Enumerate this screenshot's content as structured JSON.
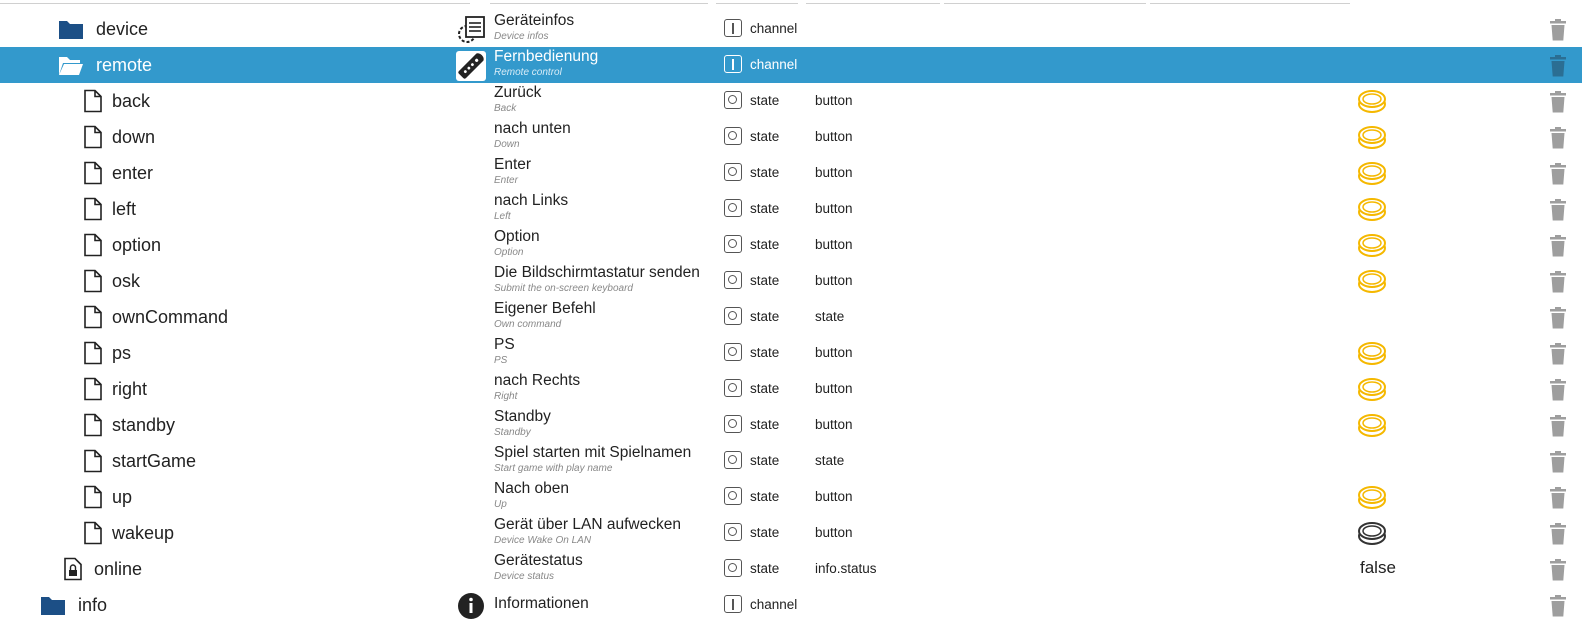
{
  "rows": [
    {
      "name": "device",
      "indent": 0,
      "tree_icon": "folder-icon",
      "role_icon": "device-info-icon",
      "title": "Geräteinfos",
      "subtitle": "Device infos",
      "type": "channel",
      "role": "",
      "value": "",
      "value_kind": "none",
      "selected": false
    },
    {
      "name": "remote",
      "indent": 0,
      "tree_icon": "folder-open-icon",
      "role_icon": "remote-control-icon",
      "title": "Fernbedienung",
      "subtitle": "Remote control",
      "type": "channel",
      "role": "",
      "value": "",
      "value_kind": "none",
      "selected": true
    },
    {
      "name": "back",
      "indent": 1,
      "tree_icon": "file-icon",
      "role_icon": "",
      "title": "Zurück",
      "subtitle": "Back",
      "type": "state",
      "role": "button",
      "value": "",
      "value_kind": "button-yellow",
      "selected": false
    },
    {
      "name": "down",
      "indent": 1,
      "tree_icon": "file-icon",
      "role_icon": "",
      "title": "nach unten",
      "subtitle": "Down",
      "type": "state",
      "role": "button",
      "value": "",
      "value_kind": "button-yellow",
      "selected": false
    },
    {
      "name": "enter",
      "indent": 1,
      "tree_icon": "file-icon",
      "role_icon": "",
      "title": "Enter",
      "subtitle": "Enter",
      "type": "state",
      "role": "button",
      "value": "",
      "value_kind": "button-yellow",
      "selected": false
    },
    {
      "name": "left",
      "indent": 1,
      "tree_icon": "file-icon",
      "role_icon": "",
      "title": "nach Links",
      "subtitle": "Left",
      "type": "state",
      "role": "button",
      "value": "",
      "value_kind": "button-yellow",
      "selected": false
    },
    {
      "name": "option",
      "indent": 1,
      "tree_icon": "file-icon",
      "role_icon": "",
      "title": "Option",
      "subtitle": "Option",
      "type": "state",
      "role": "button",
      "value": "",
      "value_kind": "button-yellow",
      "selected": false
    },
    {
      "name": "osk",
      "indent": 1,
      "tree_icon": "file-icon",
      "role_icon": "",
      "title": "Die Bildschirmtastatur senden",
      "subtitle": "Submit the on-screen keyboard",
      "type": "state",
      "role": "button",
      "value": "",
      "value_kind": "button-yellow",
      "selected": false
    },
    {
      "name": "ownCommand",
      "indent": 1,
      "tree_icon": "file-icon",
      "role_icon": "",
      "title": "Eigener Befehl",
      "subtitle": "Own command",
      "type": "state",
      "role": "state",
      "value": "",
      "value_kind": "none",
      "selected": false
    },
    {
      "name": "ps",
      "indent": 1,
      "tree_icon": "file-icon",
      "role_icon": "",
      "title": "PS",
      "subtitle": "PS",
      "type": "state",
      "role": "button",
      "value": "",
      "value_kind": "button-yellow",
      "selected": false
    },
    {
      "name": "right",
      "indent": 1,
      "tree_icon": "file-icon",
      "role_icon": "",
      "title": "nach Rechts",
      "subtitle": "Right",
      "type": "state",
      "role": "button",
      "value": "",
      "value_kind": "button-yellow",
      "selected": false
    },
    {
      "name": "standby",
      "indent": 1,
      "tree_icon": "file-icon",
      "role_icon": "",
      "title": "Standby",
      "subtitle": "Standby",
      "type": "state",
      "role": "button",
      "value": "",
      "value_kind": "button-yellow",
      "selected": false
    },
    {
      "name": "startGame",
      "indent": 1,
      "tree_icon": "file-icon",
      "role_icon": "",
      "title": "Spiel starten mit Spielnamen",
      "subtitle": "Start game with play name",
      "type": "state",
      "role": "state",
      "value": "",
      "value_kind": "none",
      "selected": false
    },
    {
      "name": "up",
      "indent": 1,
      "tree_icon": "file-icon",
      "role_icon": "",
      "title": "Nach oben",
      "subtitle": "Up",
      "type": "state",
      "role": "button",
      "value": "",
      "value_kind": "button-yellow",
      "selected": false
    },
    {
      "name": "wakeup",
      "indent": 1,
      "tree_icon": "file-icon",
      "role_icon": "",
      "title": "Gerät über LAN aufwecken",
      "subtitle": "Device Wake On LAN",
      "type": "state",
      "role": "button",
      "value": "",
      "value_kind": "button-dark",
      "selected": false
    },
    {
      "name": "online",
      "indent": 0,
      "tree_icon": "file-lock-icon",
      "role_icon": "",
      "title": "Gerätestatus",
      "subtitle": "Device status",
      "type": "state",
      "role": "info.status",
      "value": "false",
      "value_kind": "text",
      "selected": false
    },
    {
      "name": "info",
      "indent": -1,
      "tree_icon": "folder-icon",
      "role_icon": "info-icon",
      "title": "Informationen",
      "subtitle": "",
      "type": "channel",
      "role": "",
      "value": "",
      "value_kind": "none",
      "selected": false
    }
  ],
  "colors": {
    "folder": "#1c4f86",
    "selected_bg": "#3399cc",
    "button_yellow": "#f5b800",
    "button_dark": "#333333",
    "trash": "#9e9e9e"
  }
}
